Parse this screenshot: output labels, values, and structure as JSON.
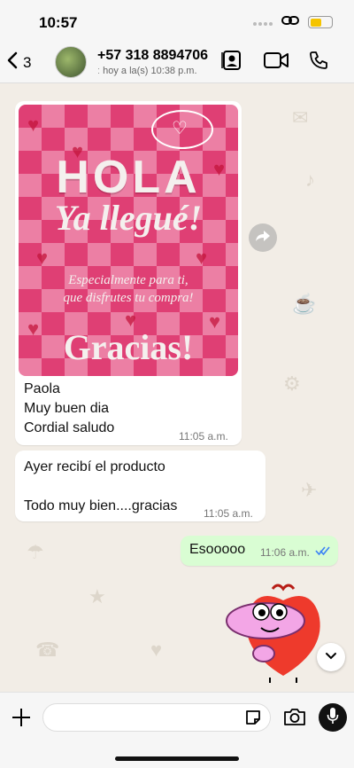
{
  "status_bar": {
    "time": "10:57"
  },
  "header": {
    "back_count": "3",
    "contact_name": "+57 318 8894706",
    "contact_status": "ː hoy a la(s) 10:38 p.m."
  },
  "messages": [
    {
      "direction": "in",
      "type": "image",
      "image_text": {
        "hola": "HOLA",
        "llegue": "Ya llegué!",
        "especial_1": "Especialmente para ti,",
        "especial_2": "que disfrutes tu compra!",
        "gracias": "Gracias!"
      },
      "caption_lines": [
        "Paola",
        "Muy buen dia",
        "Cordial saludo"
      ],
      "time": "11:05 a.m."
    },
    {
      "direction": "in",
      "type": "text",
      "lines": [
        "Ayer recibí el producto",
        "",
        "Todo muy bien....gracias"
      ],
      "time": "11:05 a.m."
    },
    {
      "direction": "out",
      "type": "text",
      "text": "Esooooo",
      "time": "11:06 a.m.",
      "status": "read"
    },
    {
      "direction": "in",
      "type": "sticker",
      "sticker": "pink-cartoon-heart-sticker"
    }
  ],
  "composer": {
    "placeholder": ""
  },
  "colors": {
    "outgoing_bubble": "#d9fdd3",
    "read_ticks": "#3b82f6",
    "battery": "#f5c400",
    "image_pink": "#e4487d"
  }
}
